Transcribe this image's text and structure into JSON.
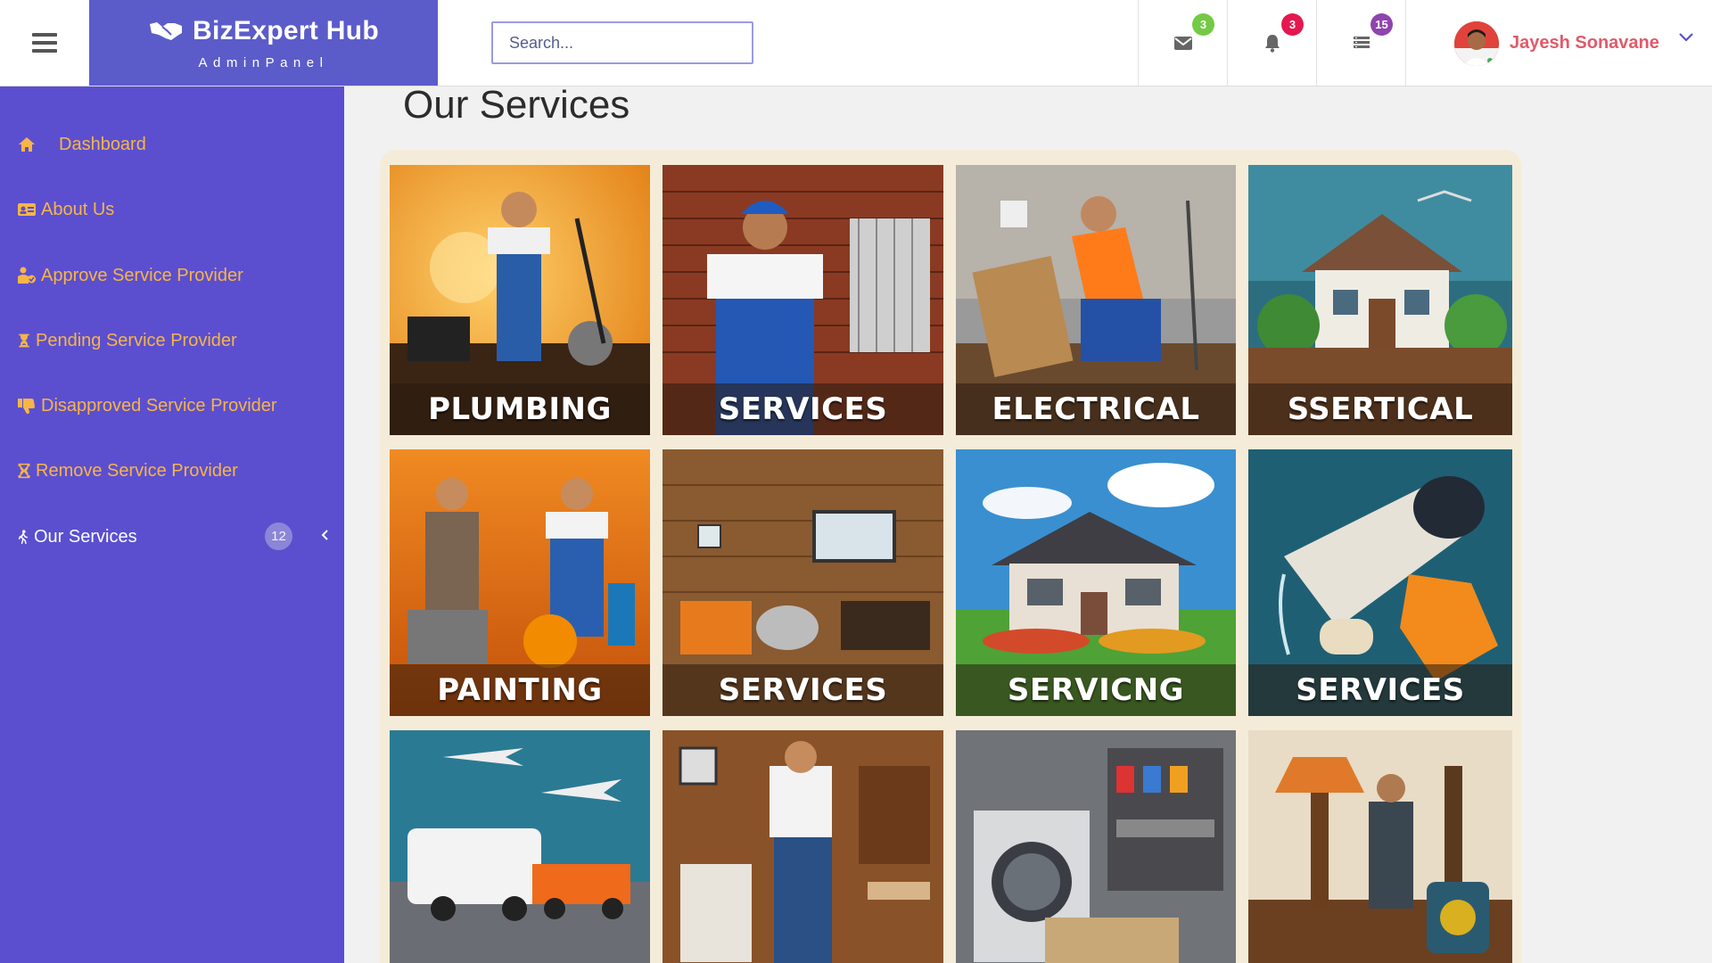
{
  "header": {
    "brand_title": "BizExpert Hub",
    "brand_subtitle": "AdminPanel",
    "search_placeholder": "Search...",
    "badges": {
      "messages": "3",
      "notifications": "3",
      "tasks": "15"
    },
    "user_name": "Jayesh Sonavane"
  },
  "sidebar": {
    "items": [
      {
        "label": "Dashboard",
        "icon": "home-icon"
      },
      {
        "label": "About Us",
        "icon": "id-card-icon"
      },
      {
        "label": "Approve Service Provider",
        "icon": "user-check-icon"
      },
      {
        "label": "Pending Service Provider",
        "icon": "hourglass-icon"
      },
      {
        "label": "Disapproved Service Provider",
        "icon": "thumbs-down-icon"
      },
      {
        "label": "Remove Service Provider",
        "icon": "hourglass-remove-icon"
      },
      {
        "label": "Our Services",
        "icon": "walking-person-icon",
        "count": "12"
      }
    ]
  },
  "main": {
    "title": "Our Services",
    "tiles": [
      {
        "label": "PLUMBING"
      },
      {
        "label": "SERVICES"
      },
      {
        "label": "ELECTRICAL"
      },
      {
        "label": "SSERTICAL"
      },
      {
        "label": "PAINTING"
      },
      {
        "label": "SERVICES"
      },
      {
        "label": "SERVICNG"
      },
      {
        "label": "SERVICES"
      },
      {
        "label": ""
      },
      {
        "label": ""
      },
      {
        "label": ""
      },
      {
        "label": ""
      }
    ]
  },
  "colors": {
    "brand": "#5b5cc9",
    "sidebar": "#5b4fd0",
    "sidebar_text": "#f7b546",
    "badge_green": "#74c946",
    "badge_red": "#e4174f",
    "badge_purple": "#8e44ad",
    "user_name": "#e15a6a"
  }
}
